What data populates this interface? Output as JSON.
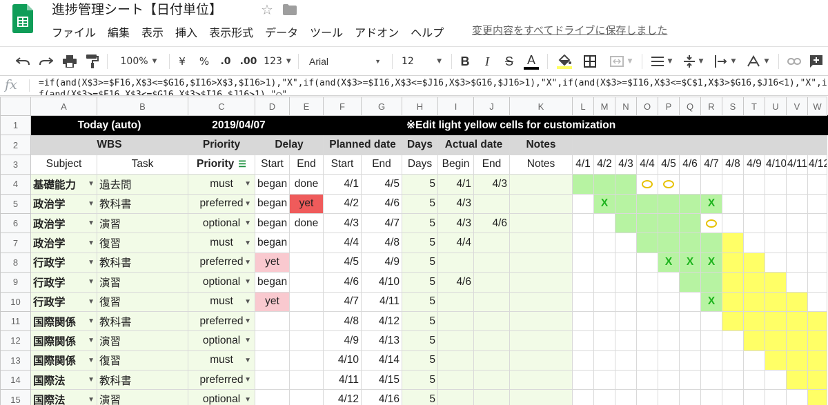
{
  "app": {
    "title": "進捗管理シート【日付単位】",
    "menus": [
      "ファイル",
      "編集",
      "表示",
      "挿入",
      "表示形式",
      "データ",
      "ツール",
      "アドオン",
      "ヘルプ"
    ],
    "save_status": "変更内容をすべてドライブに保存しました"
  },
  "toolbar": {
    "zoom": "100%",
    "currency": "¥",
    "percent": "%",
    "dec_less": ".0",
    "dec_more": ".00",
    "format_more": "123",
    "font": "Arial",
    "font_size": "12",
    "bold": "B",
    "italic": "I",
    "strike": "S",
    "text_color": "A"
  },
  "formula": {
    "label": "fx",
    "text": "=if(and(X$3>=$F16,X$3<=$G16,$I16>X$3,$I16>1),\"X\",if(and(X$3>=$I16,X$3<=$J16,X$3>$G16,$J16>1),\"X\",if(and(X$3>=$I16,X$3<=$C$1,X$3>$G16,$J16<1),\"X\",if(and(X$3>=$F16,X$3<=$G16,X$3>$I16,$J16>1),\"○\","
  },
  "columns": [
    "A",
    "B",
    "C",
    "D",
    "E",
    "F",
    "G",
    "H",
    "I",
    "J",
    "K",
    "L",
    "M",
    "N",
    "O",
    "P",
    "Q",
    "R",
    "S",
    "T",
    "U",
    "V",
    "W"
  ],
  "sheet": {
    "row1": {
      "today_label": "Today (auto)",
      "today_date": "2019/04/07",
      "edit_note": "※Edit light yellow cells for customization"
    },
    "row2": {
      "wbs": "WBS",
      "priority": "Priority",
      "delay": "Delay",
      "planned": "Planned date",
      "days": "Days",
      "actual": "Actual date",
      "notes": "Notes"
    },
    "row3": {
      "subject": "Subject",
      "task": "Task",
      "priority": "Priority",
      "start": "Start",
      "end": "End",
      "pstart": "Start",
      "pend": "End",
      "days": "Days",
      "begin": "Begin",
      "aend": "End",
      "notes": "Notes"
    },
    "dates": [
      "4/1",
      "4/2",
      "4/3",
      "4/4",
      "4/5",
      "4/6",
      "4/7",
      "4/8",
      "4/9",
      "4/10",
      "4/11",
      "4/12"
    ],
    "rows": [
      {
        "n": "4",
        "subject": "基礎能力",
        "task": "過去問",
        "priority": "must",
        "dstart": "began",
        "dend": "done",
        "pstart": "4/1",
        "pend": "4/5",
        "days": "5",
        "abegin": "4/1",
        "aend": "4/3"
      },
      {
        "n": "5",
        "subject": "政治学",
        "task": "教科書",
        "priority": "preferred",
        "dstart": "began",
        "dend": "yet",
        "pstart": "4/2",
        "pend": "4/6",
        "days": "5",
        "abegin": "4/3",
        "aend": ""
      },
      {
        "n": "6",
        "subject": "政治学",
        "task": "演習",
        "priority": "optional",
        "dstart": "began",
        "dend": "done",
        "pstart": "4/3",
        "pend": "4/7",
        "days": "5",
        "abegin": "4/3",
        "aend": "4/6"
      },
      {
        "n": "7",
        "subject": "政治学",
        "task": "復習",
        "priority": "must",
        "dstart": "began",
        "dend": "",
        "pstart": "4/4",
        "pend": "4/8",
        "days": "5",
        "abegin": "4/4",
        "aend": ""
      },
      {
        "n": "8",
        "subject": "行政学",
        "task": "教科書",
        "priority": "preferred",
        "dstart": "yet",
        "dend": "",
        "pstart": "4/5",
        "pend": "4/9",
        "days": "5",
        "abegin": "",
        "aend": ""
      },
      {
        "n": "9",
        "subject": "行政学",
        "task": "演習",
        "priority": "optional",
        "dstart": "began",
        "dend": "",
        "pstart": "4/6",
        "pend": "4/10",
        "days": "5",
        "abegin": "4/6",
        "aend": ""
      },
      {
        "n": "10",
        "subject": "行政学",
        "task": "復習",
        "priority": "must",
        "dstart": "yet",
        "dend": "",
        "pstart": "4/7",
        "pend": "4/11",
        "days": "5",
        "abegin": "",
        "aend": ""
      },
      {
        "n": "11",
        "subject": "国際関係",
        "task": "教科書",
        "priority": "preferred",
        "dstart": "",
        "dend": "",
        "pstart": "4/8",
        "pend": "4/12",
        "days": "5",
        "abegin": "",
        "aend": ""
      },
      {
        "n": "12",
        "subject": "国際関係",
        "task": "演習",
        "priority": "optional",
        "dstart": "",
        "dend": "",
        "pstart": "4/9",
        "pend": "4/13",
        "days": "5",
        "abegin": "",
        "aend": ""
      },
      {
        "n": "13",
        "subject": "国際関係",
        "task": "復習",
        "priority": "must",
        "dstart": "",
        "dend": "",
        "pstart": "4/10",
        "pend": "4/14",
        "days": "5",
        "abegin": "",
        "aend": ""
      },
      {
        "n": "14",
        "subject": "国際法",
        "task": "教科書",
        "priority": "preferred",
        "dstart": "",
        "dend": "",
        "pstart": "4/11",
        "pend": "4/15",
        "days": "5",
        "abegin": "",
        "aend": ""
      },
      {
        "n": "15",
        "subject": "国際法",
        "task": "演習",
        "priority": "optional",
        "dstart": "",
        "dend": "",
        "pstart": "4/12",
        "pend": "4/16",
        "days": "5",
        "abegin": "",
        "aend": ""
      }
    ],
    "gantt": [
      [
        "g",
        "g",
        "g",
        "c",
        "c",
        "",
        "",
        "",
        "",
        "",
        "",
        ""
      ],
      [
        "",
        "gX",
        "g",
        "g",
        "g",
        "g",
        "gX",
        "",
        "",
        "",
        "",
        ""
      ],
      [
        "",
        "",
        "g",
        "g",
        "g",
        "g",
        "c",
        "",
        "",
        "",
        "",
        ""
      ],
      [
        "",
        "",
        "",
        "g",
        "g",
        "g",
        "g",
        "y",
        "",
        "",
        "",
        ""
      ],
      [
        "",
        "",
        "",
        "",
        "gX",
        "gX",
        "gX",
        "y",
        "y",
        "",
        "",
        ""
      ],
      [
        "",
        "",
        "",
        "",
        "",
        "g",
        "g",
        "y",
        "y",
        "y",
        "",
        ""
      ],
      [
        "",
        "",
        "",
        "",
        "",
        "",
        "gX",
        "y",
        "y",
        "y",
        "y",
        ""
      ],
      [
        "",
        "",
        "",
        "",
        "",
        "",
        "",
        "y",
        "y",
        "y",
        "y",
        "y"
      ],
      [
        "",
        "",
        "",
        "",
        "",
        "",
        "",
        "",
        "y",
        "y",
        "y",
        "y"
      ],
      [
        "",
        "",
        "",
        "",
        "",
        "",
        "",
        "",
        "",
        "y",
        "y",
        "y"
      ],
      [
        "",
        "",
        "",
        "",
        "",
        "",
        "",
        "",
        "",
        "",
        "y",
        "y"
      ],
      [
        "",
        "",
        "",
        "",
        "",
        "",
        "",
        "",
        "",
        "",
        "",
        "y"
      ]
    ],
    "mark_x": "X",
    "colors": {
      "green": "#b7f3a2",
      "yellow": "#ffff66",
      "pink": "#f9c9cf",
      "red": "#ef5b5b",
      "light_green": "#f2fbe7"
    }
  }
}
